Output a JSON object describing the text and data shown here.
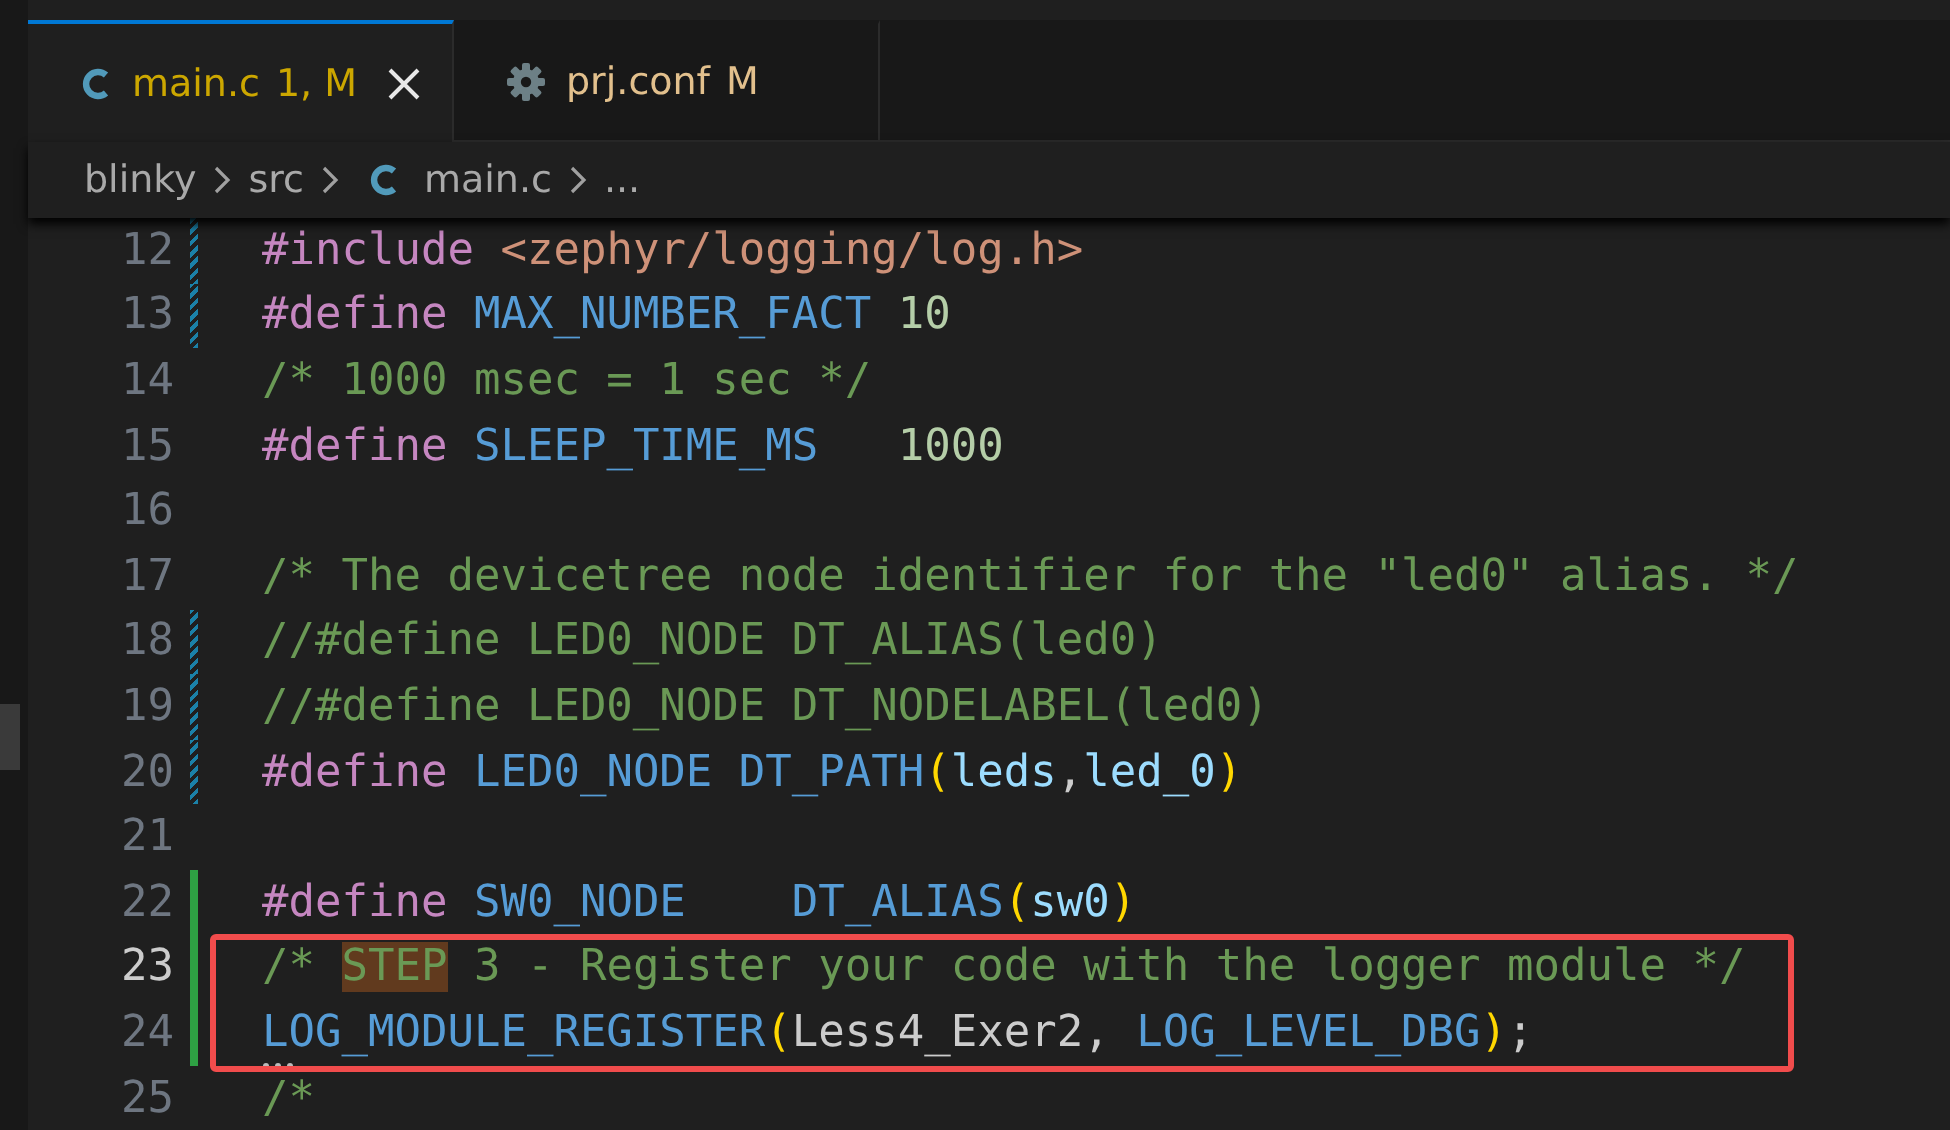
{
  "tabs": [
    {
      "kind": "c-file",
      "label": "main.c",
      "status": "1, M",
      "color": "#cca700",
      "selected": true,
      "closable": true
    },
    {
      "kind": "config-file",
      "label": "prj.conf",
      "status": "M",
      "color": "#e2c08d",
      "selected": false,
      "closable": false
    }
  ],
  "breadcrumb": {
    "items": [
      {
        "label": "blinky",
        "kind": "folder"
      },
      {
        "label": "src",
        "kind": "folder"
      },
      {
        "label": "main.c",
        "kind": "c-file"
      }
    ],
    "more": "..."
  },
  "lines": [
    {
      "number": "12",
      "modified": true,
      "added": false,
      "current": false,
      "boxed": false,
      "hint": false,
      "tokens": [
        {
          "text": "#include ",
          "kind": "kw"
        },
        {
          "text": "<zephyr/logging/log.h>",
          "kind": "str"
        }
      ]
    },
    {
      "number": "13",
      "modified": true,
      "added": false,
      "current": false,
      "boxed": false,
      "hint": false,
      "tokens": [
        {
          "text": "#define ",
          "kind": "kw"
        },
        {
          "text": "MAX_NUMBER_FACT ",
          "kind": "macro"
        },
        {
          "text": "10",
          "kind": "num"
        }
      ]
    },
    {
      "number": "14",
      "modified": false,
      "added": false,
      "current": false,
      "boxed": false,
      "hint": false,
      "tokens": [
        {
          "text": "/* 1000 msec = 1 sec */",
          "kind": "comment"
        }
      ]
    },
    {
      "number": "15",
      "modified": false,
      "added": false,
      "current": false,
      "boxed": false,
      "hint": false,
      "tokens": [
        {
          "text": "#define ",
          "kind": "kw"
        },
        {
          "text": "SLEEP_TIME_MS   ",
          "kind": "macro"
        },
        {
          "text": "1000",
          "kind": "num"
        }
      ]
    },
    {
      "number": "16",
      "modified": false,
      "added": false,
      "current": false,
      "boxed": false,
      "hint": false
    },
    {
      "number": "17",
      "modified": false,
      "added": false,
      "current": false,
      "boxed": false,
      "hint": false,
      "tokens": [
        {
          "text": "/* The devicetree node identifier for the \"led0\" alias. */",
          "kind": "comment"
        }
      ]
    },
    {
      "number": "18",
      "modified": true,
      "added": false,
      "current": false,
      "boxed": false,
      "hint": false,
      "tokens": [
        {
          "text": "//#define LED0_NODE DT_ALIAS(led0)",
          "kind": "comment"
        }
      ]
    },
    {
      "number": "19",
      "modified": true,
      "added": false,
      "current": false,
      "boxed": false,
      "hint": false,
      "tokens": [
        {
          "text": "//#define LED0_NODE DT_NODELABEL(led0)",
          "kind": "comment"
        }
      ]
    },
    {
      "number": "20",
      "modified": true,
      "added": false,
      "current": false,
      "boxed": false,
      "hint": false,
      "tokens": [
        {
          "text": "#define ",
          "kind": "kw"
        },
        {
          "text": "LED0_NODE DT_PATH",
          "kind": "macro"
        },
        {
          "text": "(",
          "kind": "paren"
        },
        {
          "text": "leds",
          "kind": "param"
        },
        {
          "text": ",",
          "kind": "plain"
        },
        {
          "text": "led_0",
          "kind": "param"
        },
        {
          "text": ")",
          "kind": "paren"
        }
      ]
    },
    {
      "number": "21",
      "modified": false,
      "added": false,
      "current": false,
      "boxed": false,
      "hint": false
    },
    {
      "number": "22",
      "modified": false,
      "added": true,
      "current": false,
      "boxed": false,
      "hint": false,
      "tokens": [
        {
          "text": "#define ",
          "kind": "kw"
        },
        {
          "text": "SW0_NODE    DT_ALIAS",
          "kind": "macro"
        },
        {
          "text": "(",
          "kind": "paren"
        },
        {
          "text": "sw0",
          "kind": "param"
        },
        {
          "text": ")",
          "kind": "paren"
        }
      ]
    },
    {
      "number": "23",
      "modified": false,
      "added": true,
      "current": true,
      "boxed": true,
      "hint": false,
      "tokens": [
        {
          "text": "/* ",
          "kind": "comment"
        },
        {
          "text": "STEP",
          "kind": "comment-match"
        },
        {
          "text": " 3 - Register your code with the logger module */",
          "kind": "comment"
        }
      ]
    },
    {
      "number": "24",
      "modified": false,
      "added": true,
      "current": false,
      "boxed": true,
      "hint": true,
      "tokens": [
        {
          "text": "LOG_MODULE_REGISTER",
          "kind": "macro"
        },
        {
          "text": "(",
          "kind": "paren"
        },
        {
          "text": "Less4_Exer2, ",
          "kind": "plain"
        },
        {
          "text": "LOG_LEVEL_DBG",
          "kind": "macro"
        },
        {
          "text": ")",
          "kind": "paren"
        },
        {
          "text": ";",
          "kind": "plain"
        }
      ]
    },
    {
      "number": "25",
      "modified": false,
      "added": false,
      "current": false,
      "boxed": false,
      "hint": false,
      "tokens": [
        {
          "text": "/*",
          "kind": "comment"
        }
      ]
    }
  ]
}
